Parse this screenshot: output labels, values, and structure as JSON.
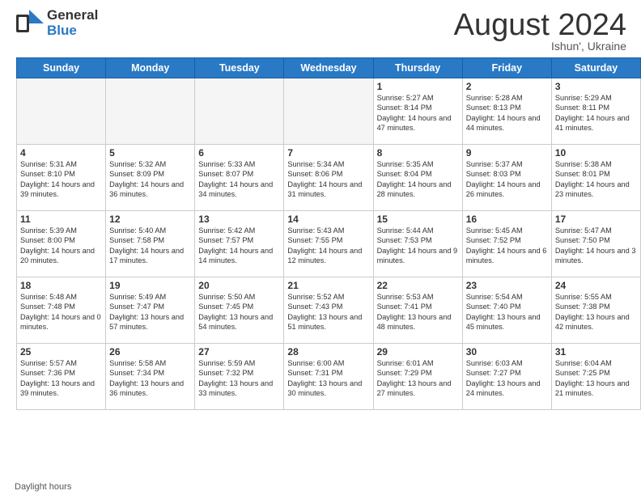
{
  "header": {
    "logo_general": "General",
    "logo_blue": "Blue",
    "month_year": "August 2024",
    "location": "Ishun', Ukraine"
  },
  "days_of_week": [
    "Sunday",
    "Monday",
    "Tuesday",
    "Wednesday",
    "Thursday",
    "Friday",
    "Saturday"
  ],
  "weeks": [
    [
      {
        "day": "",
        "info": ""
      },
      {
        "day": "",
        "info": ""
      },
      {
        "day": "",
        "info": ""
      },
      {
        "day": "",
        "info": ""
      },
      {
        "day": "1",
        "info": "Sunrise: 5:27 AM\nSunset: 8:14 PM\nDaylight: 14 hours and 47 minutes."
      },
      {
        "day": "2",
        "info": "Sunrise: 5:28 AM\nSunset: 8:13 PM\nDaylight: 14 hours and 44 minutes."
      },
      {
        "day": "3",
        "info": "Sunrise: 5:29 AM\nSunset: 8:11 PM\nDaylight: 14 hours and 41 minutes."
      }
    ],
    [
      {
        "day": "4",
        "info": "Sunrise: 5:31 AM\nSunset: 8:10 PM\nDaylight: 14 hours and 39 minutes."
      },
      {
        "day": "5",
        "info": "Sunrise: 5:32 AM\nSunset: 8:09 PM\nDaylight: 14 hours and 36 minutes."
      },
      {
        "day": "6",
        "info": "Sunrise: 5:33 AM\nSunset: 8:07 PM\nDaylight: 14 hours and 34 minutes."
      },
      {
        "day": "7",
        "info": "Sunrise: 5:34 AM\nSunset: 8:06 PM\nDaylight: 14 hours and 31 minutes."
      },
      {
        "day": "8",
        "info": "Sunrise: 5:35 AM\nSunset: 8:04 PM\nDaylight: 14 hours and 28 minutes."
      },
      {
        "day": "9",
        "info": "Sunrise: 5:37 AM\nSunset: 8:03 PM\nDaylight: 14 hours and 26 minutes."
      },
      {
        "day": "10",
        "info": "Sunrise: 5:38 AM\nSunset: 8:01 PM\nDaylight: 14 hours and 23 minutes."
      }
    ],
    [
      {
        "day": "11",
        "info": "Sunrise: 5:39 AM\nSunset: 8:00 PM\nDaylight: 14 hours and 20 minutes."
      },
      {
        "day": "12",
        "info": "Sunrise: 5:40 AM\nSunset: 7:58 PM\nDaylight: 14 hours and 17 minutes."
      },
      {
        "day": "13",
        "info": "Sunrise: 5:42 AM\nSunset: 7:57 PM\nDaylight: 14 hours and 14 minutes."
      },
      {
        "day": "14",
        "info": "Sunrise: 5:43 AM\nSunset: 7:55 PM\nDaylight: 14 hours and 12 minutes."
      },
      {
        "day": "15",
        "info": "Sunrise: 5:44 AM\nSunset: 7:53 PM\nDaylight: 14 hours and 9 minutes."
      },
      {
        "day": "16",
        "info": "Sunrise: 5:45 AM\nSunset: 7:52 PM\nDaylight: 14 hours and 6 minutes."
      },
      {
        "day": "17",
        "info": "Sunrise: 5:47 AM\nSunset: 7:50 PM\nDaylight: 14 hours and 3 minutes."
      }
    ],
    [
      {
        "day": "18",
        "info": "Sunrise: 5:48 AM\nSunset: 7:48 PM\nDaylight: 14 hours and 0 minutes."
      },
      {
        "day": "19",
        "info": "Sunrise: 5:49 AM\nSunset: 7:47 PM\nDaylight: 13 hours and 57 minutes."
      },
      {
        "day": "20",
        "info": "Sunrise: 5:50 AM\nSunset: 7:45 PM\nDaylight: 13 hours and 54 minutes."
      },
      {
        "day": "21",
        "info": "Sunrise: 5:52 AM\nSunset: 7:43 PM\nDaylight: 13 hours and 51 minutes."
      },
      {
        "day": "22",
        "info": "Sunrise: 5:53 AM\nSunset: 7:41 PM\nDaylight: 13 hours and 48 minutes."
      },
      {
        "day": "23",
        "info": "Sunrise: 5:54 AM\nSunset: 7:40 PM\nDaylight: 13 hours and 45 minutes."
      },
      {
        "day": "24",
        "info": "Sunrise: 5:55 AM\nSunset: 7:38 PM\nDaylight: 13 hours and 42 minutes."
      }
    ],
    [
      {
        "day": "25",
        "info": "Sunrise: 5:57 AM\nSunset: 7:36 PM\nDaylight: 13 hours and 39 minutes."
      },
      {
        "day": "26",
        "info": "Sunrise: 5:58 AM\nSunset: 7:34 PM\nDaylight: 13 hours and 36 minutes."
      },
      {
        "day": "27",
        "info": "Sunrise: 5:59 AM\nSunset: 7:32 PM\nDaylight: 13 hours and 33 minutes."
      },
      {
        "day": "28",
        "info": "Sunrise: 6:00 AM\nSunset: 7:31 PM\nDaylight: 13 hours and 30 minutes."
      },
      {
        "day": "29",
        "info": "Sunrise: 6:01 AM\nSunset: 7:29 PM\nDaylight: 13 hours and 27 minutes."
      },
      {
        "day": "30",
        "info": "Sunrise: 6:03 AM\nSunset: 7:27 PM\nDaylight: 13 hours and 24 minutes."
      },
      {
        "day": "31",
        "info": "Sunrise: 6:04 AM\nSunset: 7:25 PM\nDaylight: 13 hours and 21 minutes."
      }
    ]
  ],
  "footer": {
    "daylight_label": "Daylight hours"
  }
}
